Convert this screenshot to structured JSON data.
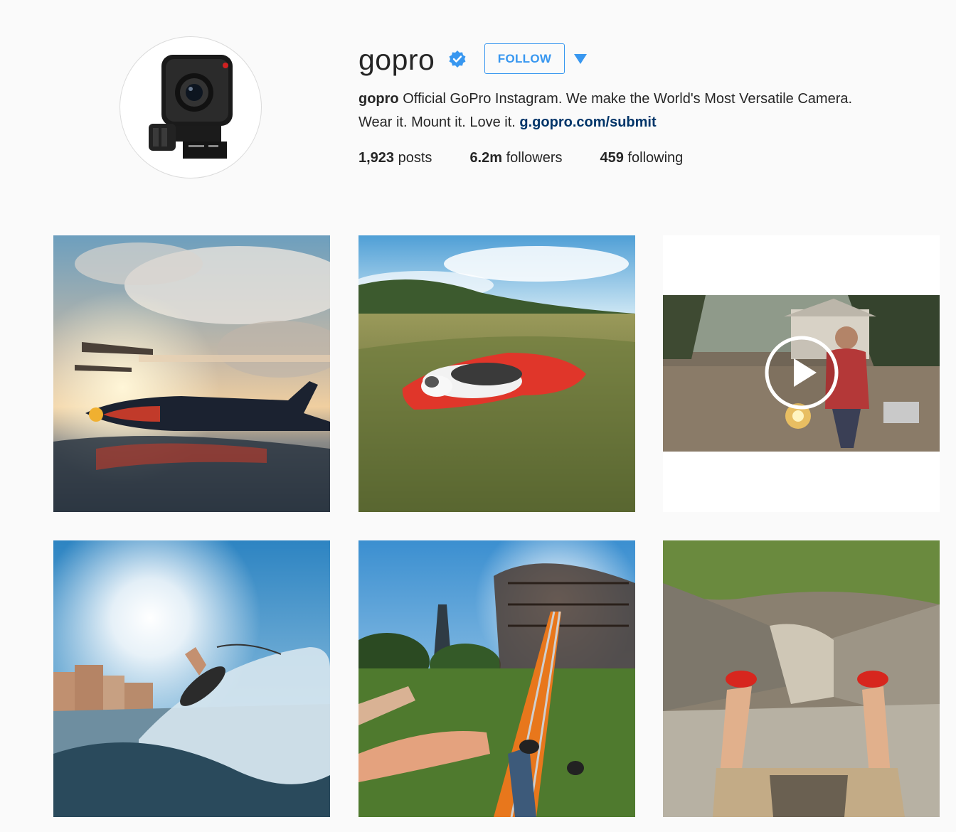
{
  "profile": {
    "username": "gopro",
    "verified": true,
    "follow_label": "FOLLOW",
    "bio_name": "gopro",
    "bio_text_line1": "Official GoPro Instagram. We make the World's Most Versatile Camera.",
    "bio_text_line2": "Wear it. Mount it. Love it.",
    "bio_link": "g.gopro.com/submit"
  },
  "stats": [
    {
      "value": "1,923",
      "label": "posts"
    },
    {
      "value": "6.2m",
      "label": "followers"
    },
    {
      "value": "459",
      "label": "following"
    }
  ],
  "icons": {
    "verified": "verified-badge-icon",
    "dropdown": "chevron-down-icon",
    "play": "play-icon"
  },
  "colors": {
    "accent": "#3897f0",
    "link": "#003569",
    "background": "#fafafa",
    "verified": "#3897f0"
  }
}
